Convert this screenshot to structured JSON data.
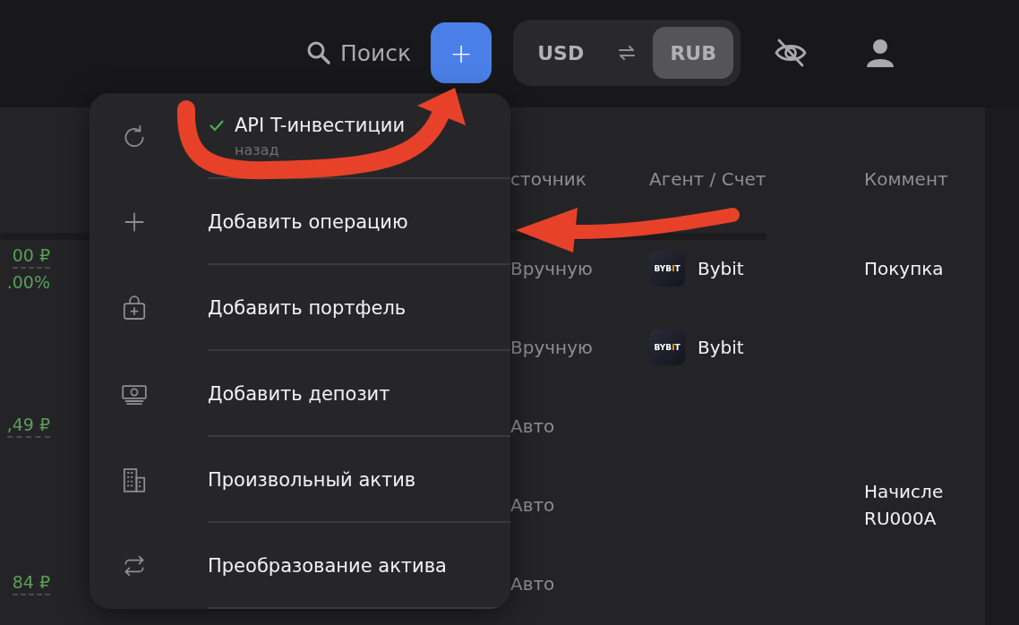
{
  "topbar": {
    "search": {
      "label": "Поиск"
    },
    "add_button": {
      "label": "+"
    },
    "currencies": [
      {
        "label": "USD",
        "selected": false
      },
      {
        "label": "RUB",
        "selected": true
      }
    ]
  },
  "table": {
    "columns": [
      "сточник",
      "Агент / Счет",
      "Коммент"
    ],
    "rows": [
      {
        "values": [
          "00 ₽",
          ".00%"
        ],
        "source": "Вручную",
        "agent": {
          "logo": "BYBIT",
          "name": "Bybit"
        },
        "comment": [
          "Покупка"
        ]
      },
      {
        "values": [],
        "source": "Вручную",
        "agent": {
          "logo": "BYBIT",
          "name": "Bybit"
        },
        "comment": []
      },
      {
        "values": [
          ",49 ₽"
        ],
        "source": "Авто",
        "comment": []
      },
      {
        "values": [],
        "source": "Авто",
        "comment": [
          "Начисле",
          "RU000A"
        ]
      },
      {
        "values": [
          "84 ₽"
        ],
        "source": "Авто",
        "comment": []
      }
    ]
  },
  "menu": [
    {
      "kind": "refresh",
      "label": "API T-инвестиции",
      "subtitle": "назад",
      "connected": true
    },
    {
      "kind": "plus",
      "label": "Добавить операцию"
    },
    {
      "kind": "briefcase",
      "label": "Добавить портфель"
    },
    {
      "kind": "cash",
      "label": "Добавить депозит"
    },
    {
      "kind": "building",
      "label": "Произвольный актив"
    },
    {
      "kind": "swap",
      "label": "Преобразование актива"
    }
  ]
}
